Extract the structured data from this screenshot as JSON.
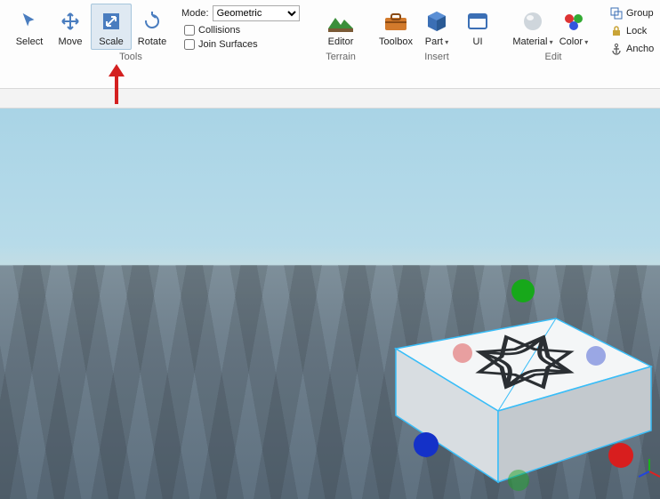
{
  "ribbon": {
    "groups": {
      "tools": {
        "label": "Tools",
        "select": {
          "label": "Select"
        },
        "move": {
          "label": "Move"
        },
        "scale": {
          "label": "Scale"
        },
        "rotate": {
          "label": "Rotate"
        }
      },
      "mode": {
        "label_text": "Mode:",
        "selected": "Geometric",
        "collisions_label": "Collisions",
        "join_label": "Join Surfaces"
      },
      "terrain": {
        "label": "Terrain",
        "editor": {
          "label": "Editor"
        }
      },
      "insert": {
        "label": "Insert",
        "toolbox": {
          "label": "Toolbox"
        },
        "part": {
          "label": "Part"
        },
        "ui": {
          "label": "UI"
        }
      },
      "edit": {
        "label": "Edit",
        "material": {
          "label": "Material"
        },
        "color": {
          "label": "Color"
        }
      },
      "right_mini": {
        "group": {
          "label": "Group"
        },
        "lock": {
          "label": "Lock"
        },
        "anchor": {
          "label": "Ancho"
        }
      }
    }
  },
  "viewport": {
    "selected_part": "Block",
    "scale_handles": [
      "x+",
      "x-",
      "y+",
      "y-",
      "z+",
      "z-"
    ]
  }
}
